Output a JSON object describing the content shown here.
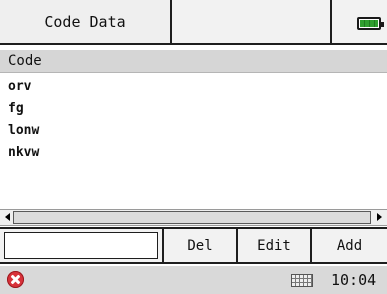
{
  "titlebar": {
    "title": "Code Data",
    "battery_icon": "battery-full-icon",
    "battery_color": "#2f9e2f"
  },
  "list": {
    "header": "Code",
    "rows": [
      "orv",
      "fg",
      "lonw",
      "nkvw"
    ]
  },
  "toolbar": {
    "input_value": "",
    "del_label": "Del",
    "edit_label": "Edit",
    "add_label": "Add"
  },
  "statusbar": {
    "close_icon": "close-icon",
    "close_color": "#d8323a",
    "keyboard_icon": "keyboard-icon",
    "time": "10:04"
  }
}
